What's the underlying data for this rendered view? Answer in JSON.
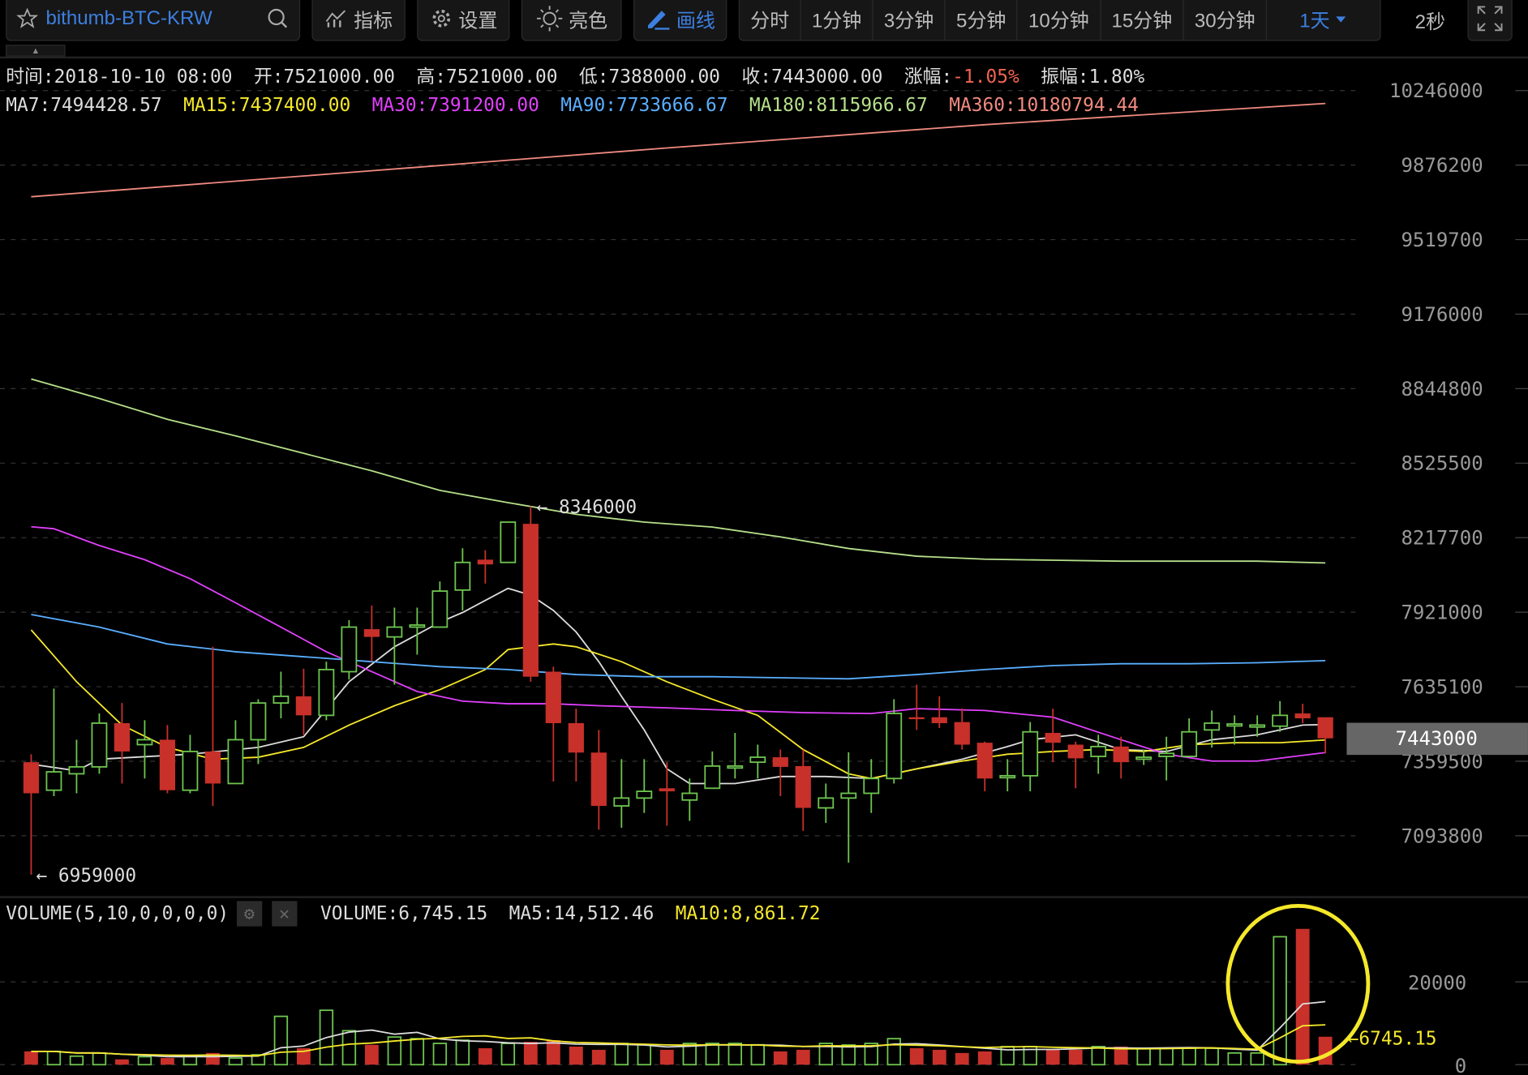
{
  "toolbar": {
    "symbol": "bithumb-BTC-KRW",
    "buttons": [
      {
        "label": "指标",
        "icon": "indicator-icon"
      },
      {
        "label": "设置",
        "icon": "gear-icon"
      },
      {
        "label": "亮色",
        "icon": "sun-icon"
      },
      {
        "label": "画线",
        "icon": "pencil-icon"
      }
    ],
    "periods": [
      "分时",
      "1分钟",
      "3分钟",
      "5分钟",
      "10分钟",
      "15分钟",
      "30分钟",
      "1天"
    ],
    "active_period": "1天",
    "refresh": "2秒"
  },
  "info": [
    {
      "label": "时间:",
      "value": "2018-10-10 08:00"
    },
    {
      "label": "开:",
      "value": "7521000.00"
    },
    {
      "label": "高:",
      "value": "7521000.00"
    },
    {
      "label": "低:",
      "value": "7388000.00"
    },
    {
      "label": "收:",
      "value": "7443000.00"
    },
    {
      "label": "涨幅:",
      "value": "-1.05%",
      "color": "#f06450"
    },
    {
      "label": "振幅:",
      "value": "1.80%"
    }
  ],
  "ma_legend": [
    {
      "label": "MA7:",
      "value": "7494428.57",
      "color": "#dddddd"
    },
    {
      "label": "MA15:",
      "value": "7437400.00",
      "color": "#f5e82a"
    },
    {
      "label": "MA30:",
      "value": "7391200.00",
      "color": "#e040fb"
    },
    {
      "label": "MA90:",
      "value": "7733666.67",
      "color": "#5aaeff"
    },
    {
      "label": "MA180:",
      "value": "8115966.67",
      "color": "#b5e08a"
    },
    {
      "label": "MA360:",
      "value": "10180794.44",
      "color": "#f08a80"
    }
  ],
  "price_axis": [
    "10246000",
    "9876200",
    "9519700",
    "9176000",
    "8844800",
    "8525500",
    "8217700",
    "7921000",
    "7635100",
    "7359500",
    "7093800"
  ],
  "current_price": "7443000",
  "high_marker": "8346000",
  "low_marker": "6959000",
  "volume": {
    "indicator": "VOLUME(5,10,0,0,0,0)",
    "legend": [
      {
        "label": "VOLUME:",
        "value": "6,745.15",
        "color": "#dddddd"
      },
      {
        "label": "MA5:",
        "value": "14,512.46",
        "color": "#dddddd"
      },
      {
        "label": "MA10:",
        "value": "8,861.72",
        "color": "#f5e82a"
      }
    ],
    "axis": [
      "20000",
      "0"
    ],
    "last_marker": "6745.15"
  },
  "colors": {
    "up": "#6ec54f",
    "down": "#c8302a",
    "accent": "#3d7fe0",
    "annotation": "#f5e82a"
  },
  "chart_data": {
    "type": "candlestick",
    "scale": "log",
    "ylim": [
      7093800,
      10246000
    ],
    "grid": true,
    "ohlc": [
      [
        7356000,
        7385000,
        6959000,
        7244000
      ],
      [
        7255000,
        7628000,
        7234000,
        7321000
      ],
      [
        7314000,
        7438000,
        7244000,
        7339000
      ],
      [
        7339000,
        7535000,
        7314000,
        7499000
      ],
      [
        7499000,
        7574000,
        7279000,
        7395000
      ],
      [
        7420000,
        7510000,
        7297000,
        7438000
      ],
      [
        7438000,
        7492000,
        7244000,
        7255000
      ],
      [
        7255000,
        7456000,
        7244000,
        7395000
      ],
      [
        7395000,
        7787000,
        7199000,
        7279000
      ],
      [
        7279000,
        7510000,
        7279000,
        7438000
      ],
      [
        7438000,
        7588000,
        7349000,
        7574000
      ],
      [
        7574000,
        7692000,
        7517000,
        7599000
      ],
      [
        7599000,
        7703000,
        7456000,
        7528000
      ],
      [
        7528000,
        7730000,
        7510000,
        7700000
      ],
      [
        7692000,
        7890000,
        7662000,
        7863000
      ],
      [
        7855000,
        7947000,
        7730000,
        7825000
      ],
      [
        7825000,
        7939000,
        7643000,
        7863000
      ],
      [
        7863000,
        7939000,
        7757000,
        7871000
      ],
      [
        7863000,
        8042000,
        7863000,
        8004000
      ],
      [
        8008000,
        8175000,
        7928000,
        8118000
      ],
      [
        8129000,
        8167000,
        8034000,
        8110000
      ],
      [
        8118000,
        8281000,
        8118000,
        8281000
      ],
      [
        8274000,
        8346000,
        7654000,
        7673000
      ],
      [
        7692000,
        7711000,
        7286000,
        7499000
      ],
      [
        7499000,
        7553000,
        7286000,
        7391000
      ],
      [
        7391000,
        7474000,
        7115000,
        7199000
      ],
      [
        7199000,
        7367000,
        7122000,
        7227000
      ],
      [
        7227000,
        7367000,
        7174000,
        7251000
      ],
      [
        7262000,
        7356000,
        7129000,
        7251000
      ],
      [
        7220000,
        7297000,
        7146000,
        7244000
      ],
      [
        7262000,
        7395000,
        7262000,
        7342000
      ],
      [
        7339000,
        7463000,
        7297000,
        7342000
      ],
      [
        7356000,
        7420000,
        7297000,
        7374000
      ],
      [
        7374000,
        7402000,
        7234000,
        7339000
      ],
      [
        7342000,
        7402000,
        7111000,
        7192000
      ],
      [
        7192000,
        7279000,
        7139000,
        7227000
      ],
      [
        7227000,
        7392000,
        7000000,
        7244000
      ],
      [
        7244000,
        7367000,
        7174000,
        7297000
      ],
      [
        7297000,
        7588000,
        7279000,
        7535000
      ],
      [
        7521000,
        7643000,
        7474000,
        7517000
      ],
      [
        7521000,
        7599000,
        7481000,
        7499000
      ],
      [
        7503000,
        7553000,
        7402000,
        7420000
      ],
      [
        7427000,
        7431000,
        7251000,
        7297000
      ],
      [
        7300000,
        7367000,
        7251000,
        7307000
      ],
      [
        7307000,
        7503000,
        7251000,
        7467000
      ],
      [
        7463000,
        7553000,
        7356000,
        7427000
      ],
      [
        7420000,
        7431000,
        7262000,
        7370000
      ],
      [
        7377000,
        7456000,
        7314000,
        7413000
      ],
      [
        7413000,
        7449000,
        7297000,
        7356000
      ],
      [
        7370000,
        7402000,
        7346000,
        7374000
      ],
      [
        7377000,
        7449000,
        7290000,
        7388000
      ],
      [
        7377000,
        7517000,
        7374000,
        7467000
      ],
      [
        7474000,
        7546000,
        7409000,
        7499000
      ],
      [
        7492000,
        7528000,
        7420000,
        7496000
      ],
      [
        7488000,
        7528000,
        7449000,
        7492000
      ],
      [
        7488000,
        7581000,
        7467000,
        7528000
      ],
      [
        7535000,
        7571000,
        7499000,
        7517000
      ],
      [
        7521000,
        7521000,
        7388000,
        7443000
      ]
    ],
    "ma": [
      {
        "name": "MA7",
        "color": "#dddddd",
        "points": [
          [
            0,
            7349000
          ],
          [
            2,
            7325000
          ],
          [
            3,
            7367000
          ],
          [
            7,
            7385000
          ],
          [
            10,
            7410000
          ],
          [
            12,
            7449000
          ],
          [
            14,
            7654000
          ],
          [
            16,
            7787000
          ],
          [
            18,
            7882000
          ],
          [
            19,
            7920000
          ],
          [
            21,
            8015000
          ],
          [
            22,
            7988000
          ],
          [
            23,
            7928000
          ],
          [
            24,
            7844000
          ],
          [
            25,
            7730000
          ],
          [
            26,
            7599000
          ],
          [
            27,
            7474000
          ],
          [
            28,
            7332000
          ],
          [
            29,
            7279000
          ],
          [
            31,
            7279000
          ],
          [
            33,
            7304000
          ],
          [
            35,
            7304000
          ],
          [
            37,
            7297000
          ],
          [
            39,
            7332000
          ],
          [
            41,
            7367000
          ],
          [
            43,
            7413000
          ],
          [
            44,
            7438000
          ],
          [
            46,
            7456000
          ],
          [
            48,
            7402000
          ],
          [
            50,
            7395000
          ],
          [
            52,
            7438000
          ],
          [
            54,
            7456000
          ],
          [
            56,
            7492000
          ],
          [
            57,
            7494000
          ]
        ]
      },
      {
        "name": "MA15",
        "color": "#f5e82a",
        "points": [
          [
            0,
            7852000
          ],
          [
            2,
            7654000
          ],
          [
            4,
            7492000
          ],
          [
            6,
            7410000
          ],
          [
            8,
            7367000
          ],
          [
            10,
            7374000
          ],
          [
            12,
            7410000
          ],
          [
            14,
            7492000
          ],
          [
            16,
            7564000
          ],
          [
            18,
            7624000
          ],
          [
            20,
            7700000
          ],
          [
            21,
            7776000
          ],
          [
            23,
            7798000
          ],
          [
            24,
            7787000
          ],
          [
            26,
            7730000
          ],
          [
            28,
            7654000
          ],
          [
            30,
            7588000
          ],
          [
            32,
            7528000
          ],
          [
            34,
            7402000
          ],
          [
            36,
            7314000
          ],
          [
            37,
            7297000
          ],
          [
            39,
            7332000
          ],
          [
            41,
            7360000
          ],
          [
            43,
            7385000
          ],
          [
            45,
            7395000
          ],
          [
            47,
            7402000
          ],
          [
            49,
            7395000
          ],
          [
            51,
            7420000
          ],
          [
            53,
            7427000
          ],
          [
            55,
            7427000
          ],
          [
            57,
            7437000
          ]
        ]
      },
      {
        "name": "MA30",
        "color": "#e040fb",
        "points": [
          [
            0,
            8262000
          ],
          [
            1,
            8254000
          ],
          [
            3,
            8186000
          ],
          [
            5,
            8129000
          ],
          [
            7,
            8053000
          ],
          [
            9,
            7958000
          ],
          [
            11,
            7863000
          ],
          [
            13,
            7768000
          ],
          [
            15,
            7692000
          ],
          [
            17,
            7617000
          ],
          [
            19,
            7581000
          ],
          [
            21,
            7571000
          ],
          [
            23,
            7571000
          ],
          [
            25,
            7564000
          ],
          [
            28,
            7556000
          ],
          [
            31,
            7546000
          ],
          [
            34,
            7538000
          ],
          [
            37,
            7535000
          ],
          [
            39,
            7553000
          ],
          [
            42,
            7546000
          ],
          [
            45,
            7521000
          ],
          [
            48,
            7438000
          ],
          [
            50,
            7385000
          ],
          [
            52,
            7360000
          ],
          [
            54,
            7360000
          ],
          [
            57,
            7391000
          ]
        ]
      },
      {
        "name": "MA90",
        "color": "#5aaeff",
        "points": [
          [
            0,
            7912000
          ],
          [
            3,
            7863000
          ],
          [
            6,
            7798000
          ],
          [
            9,
            7768000
          ],
          [
            12,
            7749000
          ],
          [
            15,
            7730000
          ],
          [
            18,
            7711000
          ],
          [
            21,
            7700000
          ],
          [
            24,
            7681000
          ],
          [
            27,
            7673000
          ],
          [
            30,
            7673000
          ],
          [
            33,
            7669000
          ],
          [
            36,
            7665000
          ],
          [
            39,
            7681000
          ],
          [
            42,
            7700000
          ],
          [
            45,
            7715000
          ],
          [
            48,
            7722000
          ],
          [
            51,
            7722000
          ],
          [
            54,
            7726000
          ],
          [
            57,
            7734000
          ]
        ]
      },
      {
        "name": "MA180",
        "color": "#b5e08a",
        "points": [
          [
            0,
            8887000
          ],
          [
            3,
            8802000
          ],
          [
            6,
            8712000
          ],
          [
            9,
            8641000
          ],
          [
            12,
            8567000
          ],
          [
            15,
            8493000
          ],
          [
            18,
            8412000
          ],
          [
            21,
            8361000
          ],
          [
            24,
            8313000
          ],
          [
            27,
            8281000
          ],
          [
            30,
            8261000
          ],
          [
            33,
            8221000
          ],
          [
            36,
            8174000
          ],
          [
            39,
            8143000
          ],
          [
            42,
            8131000
          ],
          [
            45,
            8127000
          ],
          [
            48,
            8123000
          ],
          [
            51,
            8123000
          ],
          [
            54,
            8123000
          ],
          [
            57,
            8116000
          ]
        ]
      },
      {
        "name": "MA360",
        "color": "#f08a80",
        "points": [
          [
            0,
            9723000
          ],
          [
            14,
            9840000
          ],
          [
            28,
            9960000
          ],
          [
            42,
            10075000
          ],
          [
            57,
            10181000
          ]
        ]
      }
    ],
    "volume": [
      3205,
      3200,
      2050,
      2820,
      1280,
      1920,
      1600,
      2050,
      2820,
      1600,
      2370,
      11670,
      3970,
      13140,
      8200,
      4800,
      6670,
      6280,
      5130,
      5900,
      3970,
      5130,
      5510,
      5900,
      4360,
      3590,
      5130,
      4800,
      3590,
      5130,
      5130,
      5130,
      4800,
      3200,
      3590,
      5130,
      4740,
      5130,
      6280,
      3970,
      3590,
      2820,
      3200,
      4360,
      4360,
      3590,
      3590,
      4360,
      4360,
      3970,
      3970,
      3970,
      3970,
      2820,
      2820,
      30900,
      32800,
      6745.15
    ],
    "volume_ylim": [
      0,
      20000
    ]
  }
}
